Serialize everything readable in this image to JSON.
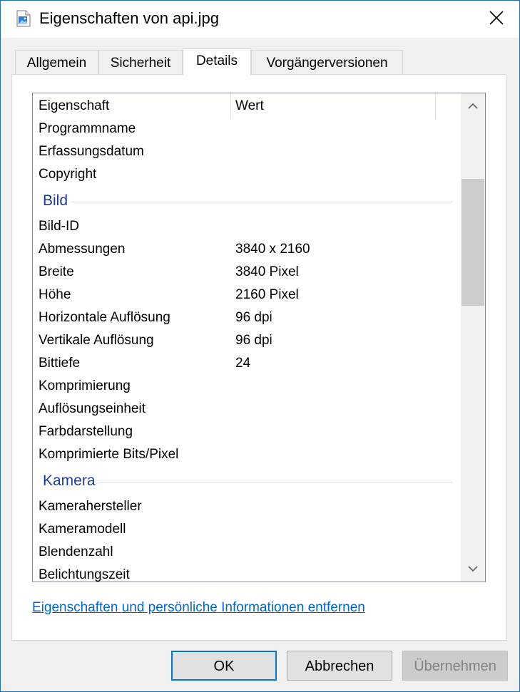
{
  "window": {
    "title": "Eigenschaften von api.jpg",
    "file_icon": "image-file-icon",
    "close_icon": "close-icon"
  },
  "tabs": [
    {
      "label": "Allgemein",
      "active": false
    },
    {
      "label": "Sicherheit",
      "active": false
    },
    {
      "label": "Details",
      "active": true
    },
    {
      "label": "Vorgängerversionen",
      "active": false
    }
  ],
  "list": {
    "columns": {
      "property": "Eigenschaft",
      "value": "Wert"
    },
    "rows_top": [
      {
        "name": "Programmname",
        "value": ""
      },
      {
        "name": "Erfassungsdatum",
        "value": ""
      },
      {
        "name": "Copyright",
        "value": ""
      }
    ],
    "group_bild": "Bild",
    "rows_bild": [
      {
        "name": "Bild-ID",
        "value": ""
      },
      {
        "name": "Abmessungen",
        "value": "3840 x 2160"
      },
      {
        "name": "Breite",
        "value": "3840 Pixel"
      },
      {
        "name": "Höhe",
        "value": "2160 Pixel"
      },
      {
        "name": "Horizontale Auflösung",
        "value": "96 dpi"
      },
      {
        "name": "Vertikale Auflösung",
        "value": "96 dpi"
      },
      {
        "name": "Bittiefe",
        "value": "24"
      },
      {
        "name": "Komprimierung",
        "value": ""
      },
      {
        "name": "Auflösungseinheit",
        "value": ""
      },
      {
        "name": "Farbdarstellung",
        "value": ""
      },
      {
        "name": "Komprimierte Bits/Pixel",
        "value": ""
      }
    ],
    "group_kamera": "Kamera",
    "rows_kamera": [
      {
        "name": "Kamerahersteller",
        "value": ""
      },
      {
        "name": "Kameramodell",
        "value": ""
      },
      {
        "name": "Blendenzahl",
        "value": ""
      },
      {
        "name": "Belichtungszeit",
        "value": ""
      }
    ]
  },
  "remove_link": "Eigenschaften und persönliche Informationen entfernen",
  "buttons": {
    "ok": "OK",
    "cancel": "Abbrechen",
    "apply": "Übernehmen"
  },
  "colors": {
    "accent": "#0078d7",
    "group_heading": "#1e3d8f",
    "link": "#0066cc"
  }
}
